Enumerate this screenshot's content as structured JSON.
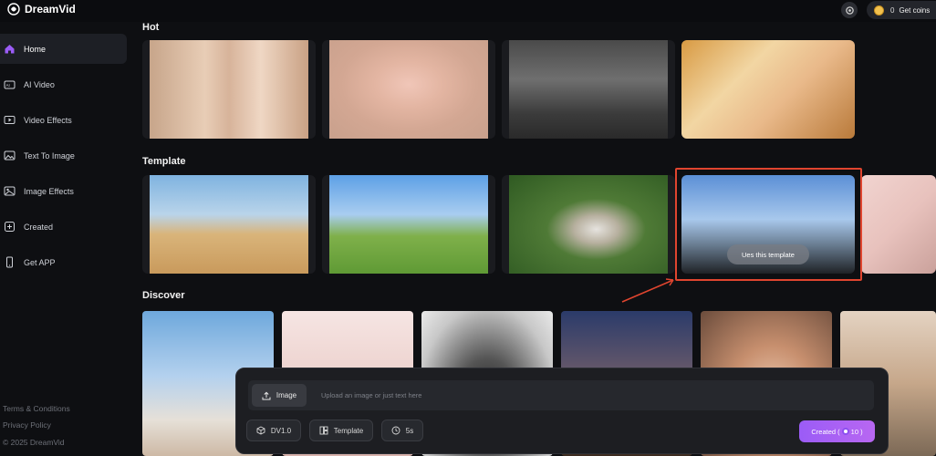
{
  "app": {
    "name": "DreamVid"
  },
  "topbar": {
    "coin_count": "0",
    "coins_label": "Get coins"
  },
  "sidebar": {
    "items": [
      {
        "label": "Home",
        "icon": "home-icon"
      },
      {
        "label": "AI Video",
        "icon": "ai-video-icon"
      },
      {
        "label": "Video Effects",
        "icon": "video-effects-icon"
      },
      {
        "label": "Text To Image",
        "icon": "text-to-image-icon"
      },
      {
        "label": "Image Effects",
        "icon": "image-effects-icon"
      },
      {
        "label": "Created",
        "icon": "created-icon"
      },
      {
        "label": "Get APP",
        "icon": "phone-icon"
      }
    ],
    "footer": {
      "terms": "Terms & Conditions",
      "privacy": "Privacy Policy",
      "copyright": "© 2025 DreamVid"
    }
  },
  "sections": {
    "hot": "Hot",
    "template": "Template",
    "discover": "Discover"
  },
  "template_overlay": {
    "button": "Ues this template"
  },
  "composer": {
    "image_button": "Image",
    "placeholder": "Upload an image or just text here",
    "model": "DV1.0",
    "template": "Template",
    "duration": "5s",
    "create_label": "Created (",
    "create_cost": "10 )"
  },
  "colors": {
    "accent": "#9b5cf6",
    "highlight": "#e0452f",
    "background": "#0e0f12"
  }
}
